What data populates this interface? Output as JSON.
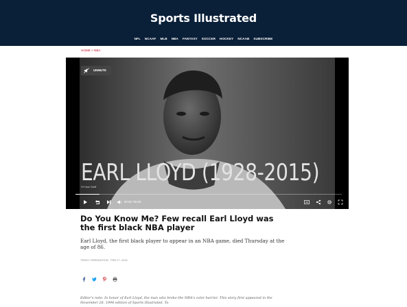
{
  "header": {
    "logo_text": "Sports Illustrated",
    "nav": [
      "NFL",
      "NCAAF",
      "MLB",
      "NBA",
      "FANTASY",
      "SOCCER",
      "HOCKEY",
      "NCAAB",
      "SUBSCRIBE"
    ]
  },
  "breadcrumb": {
    "home": "HOME",
    "sep": ">",
    "section": "NBA"
  },
  "video": {
    "unmute_label": "UNMUTE",
    "overlay_title": "EARL LLOYD (1928-2015)",
    "overlay_sub": "SI How Stuff",
    "time": "00:23 / 00:40",
    "progress": 0.09
  },
  "article": {
    "headline": "Do You Know Me? Few recall Earl Lloyd was the first black NBA player",
    "dek": "Earl Lloyd, the first black player to appear in an NBA game, died Thursday at the age of 86.",
    "byline": "TEDDY GREENSTEIN · FEB 27, 2015",
    "editor_note": "Editor's note: In honor of Earl Lloyd, the man who broke the NBA's color barrier. This story first appeared in the November 28, 1994 edition of Sports Illustrated. To"
  },
  "share": [
    "facebook-icon",
    "twitter-icon",
    "pinterest-icon",
    "print-icon"
  ],
  "colors": {
    "header_bg": "#0a1f38",
    "accent": "#c8102e",
    "share_facebook": "#3b5998",
    "share_twitter": "#1da1f2",
    "share_pinterest": "#cb2027",
    "share_print": "#555555"
  }
}
